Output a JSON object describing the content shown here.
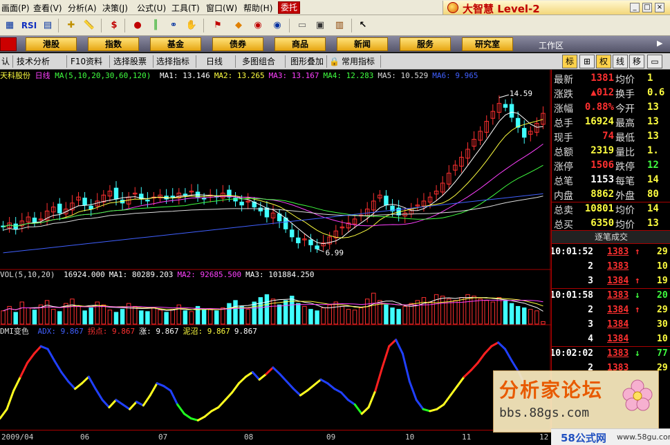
{
  "menu": {
    "items": [
      "画面(P)",
      "查看(V)",
      "分析(A)",
      "决策(J)",
      "公式(U)",
      "工具(T)",
      "窗口(W)",
      "帮助(H)"
    ],
    "entrust": "委托",
    "brand": "大智慧 Level-2"
  },
  "toolbar": {
    "rsi": "RSI",
    "dollar": "$"
  },
  "nav": {
    "buttons": [
      "港股",
      "指数",
      "基金",
      "债券",
      "商品",
      "新闻",
      "服务",
      "研究室"
    ],
    "workzone": "工作区"
  },
  "subbar": {
    "items": [
      "认",
      "技术分析",
      "F10资料",
      "选择股票",
      "选择指标",
      "日线",
      "多图组合",
      "图形叠加",
      "常用指标"
    ],
    "tabs": [
      "标",
      "⊞",
      "权",
      "线",
      "移"
    ]
  },
  "chart": {
    "stock_name": "天科股份",
    "period": "日线",
    "ma_label": "MA(5,10,20,30,60,120)",
    "ma_values": [
      {
        "label": "MA1: 13.146",
        "color": "#ffffff"
      },
      {
        "label": "MA2: 13.265",
        "color": "#ffff40"
      },
      {
        "label": "MA3: 13.167",
        "color": "#ff40ff"
      },
      {
        "label": "MA4: 12.283",
        "color": "#40ff40"
      },
      {
        "label": "MA5: 10.529",
        "color": "#dddddd"
      },
      {
        "label": "MA6: 9.965",
        "color": "#4060ff"
      }
    ],
    "high_label": "14.59",
    "low_label": "6.99",
    "vol_label": "VOL(5,10,20)",
    "vol_values": [
      {
        "label": "16924.000",
        "color": "#ffffff"
      },
      {
        "label": "MA1: 80289.203",
        "color": "#ffffff"
      },
      {
        "label": "MA2: 92685.500",
        "color": "#ff40ff"
      },
      {
        "label": "MA3: 101884.250",
        "color": "#ffffff"
      }
    ],
    "dmi_label": "DMI变色",
    "dmi_values": [
      {
        "label": "ADX: 9.867",
        "color": "#4060ff"
      },
      {
        "label": "拐点: 9.867",
        "color": "#ff3030"
      },
      {
        "label": "涨: 9.867",
        "color": "#ffffff"
      },
      {
        "label": "泥沼: 9.867",
        "color": "#ffff40"
      },
      {
        "label": "9.867",
        "color": "#ffffff"
      }
    ],
    "x_labels": [
      "2009/04",
      "06",
      "07",
      "08",
      "09",
      "10",
      "11",
      "12"
    ]
  },
  "chart_data": {
    "type": "candlestick",
    "price": {
      "ylim": [
        6,
        15.5
      ],
      "close": [
        8.1,
        8.3,
        8.0,
        8.4,
        8.6,
        8.3,
        8.5,
        8.9,
        9.1,
        8.8,
        9.0,
        9.3,
        9.6,
        9.2,
        9.0,
        9.4,
        9.7,
        9.9,
        9.5,
        9.3,
        9.6,
        9.8,
        9.5,
        9.4,
        9.6,
        9.7,
        9.5,
        9.6,
        9.8,
        9.7,
        9.9,
        9.6,
        9.5,
        9.7,
        9.6,
        9.8,
        9.6,
        9.4,
        9.2,
        9.4,
        9.1,
        8.9,
        8.6,
        8.8,
        8.4,
        8.0,
        7.6,
        7.3,
        7.5,
        7.2,
        7.0,
        7.3,
        7.6,
        7.9,
        8.1,
        8.3,
        8.5,
        8.7,
        9.0,
        9.4,
        9.7,
        9.2,
        8.9,
        8.7,
        8.8,
        9.0,
        9.2,
        9.4,
        9.6,
        9.9,
        10.3,
        10.8,
        11.2,
        11.6,
        12.0,
        12.5,
        12.9,
        13.4,
        13.9,
        14.3,
        14.1,
        13.6,
        13.1,
        12.6,
        12.9,
        13.3,
        13.8
      ],
      "high_value": 14.59,
      "low_value": 6.99
    },
    "volume": {
      "ylim": [
        0,
        300000
      ],
      "values": [
        90000,
        120000,
        80000,
        150000,
        110000,
        95000,
        130000,
        160000,
        100000,
        85000,
        140000,
        170000,
        120000,
        90000,
        110000,
        150000,
        130000,
        95000,
        80000,
        100000,
        140000,
        120000,
        90000,
        85000,
        110000,
        95000,
        80000,
        100000,
        130000,
        90000,
        85000,
        120000,
        95000,
        100000,
        90000,
        110000,
        140000,
        160000,
        120000,
        100000,
        150000,
        180000,
        200000,
        170000,
        130000,
        160000,
        190000,
        140000,
        120000,
        100000,
        90000,
        110000,
        130000,
        150000,
        120000,
        100000,
        95000,
        110000,
        170000,
        210000,
        160000,
        130000,
        110000,
        100000,
        120000,
        140000,
        160000,
        180000,
        150000,
        200000,
        190000,
        170000,
        160000,
        180000,
        200000,
        190000,
        170000,
        160000,
        150000,
        180000,
        160000,
        140000,
        120000,
        110000,
        100000,
        90000,
        16924
      ]
    },
    "dmi": {
      "ylim": [
        0,
        100
      ],
      "values": [
        10,
        20,
        40,
        55,
        70,
        80,
        88,
        85,
        72,
        60,
        50,
        42,
        48,
        55,
        42,
        30,
        22,
        30,
        25,
        20,
        28,
        24,
        35,
        48,
        45,
        40,
        25,
        15,
        10,
        8,
        12,
        18,
        22,
        30,
        38,
        48,
        55,
        60,
        52,
        58,
        65,
        58,
        50,
        42,
        35,
        40,
        46,
        52,
        48,
        42,
        38,
        30,
        25,
        15,
        22,
        40,
        65,
        88,
        95,
        80,
        50,
        30,
        20,
        18,
        20,
        25,
        35,
        45,
        55,
        62,
        70,
        80,
        88,
        92,
        85,
        72,
        60,
        45,
        30
      ]
    }
  },
  "quote": {
    "rows": [
      {
        "l1": "最新",
        "v1": "1381",
        "c1": "red",
        "l2": "均价",
        "v2": "1",
        "c2": "yellow"
      },
      {
        "l1": "涨跌",
        "v1": "▲012",
        "c1": "red",
        "l2": "换手",
        "v2": "0.6",
        "c2": "yellow"
      },
      {
        "l1": "涨幅",
        "v1": "0.88%",
        "c1": "red",
        "l2": "今开",
        "v2": "13",
        "c2": "yellow"
      },
      {
        "l1": "总手",
        "v1": "16924",
        "c1": "yellow",
        "l2": "最高",
        "v2": "13",
        "c2": "yellow"
      },
      {
        "l1": "现手",
        "v1": "74",
        "c1": "red",
        "l2": "最低",
        "v2": "13",
        "c2": "yellow"
      },
      {
        "l1": "总额",
        "v1": "2319",
        "c1": "yellow",
        "l2": "量比",
        "v2": "1.",
        "c2": "yellow"
      },
      {
        "l1": "涨停",
        "v1": "1506",
        "c1": "red",
        "l2": "跌停",
        "v2": "12",
        "c2": "green"
      },
      {
        "l1": "总笔",
        "v1": "1153",
        "c1": "white",
        "l2": "每笔",
        "v2": "14",
        "c2": "yellow"
      },
      {
        "l1": "内盘",
        "v1": "8862",
        "c1": "yellow",
        "l2": "外盘",
        "v2": "80",
        "c2": "yellow"
      },
      {
        "l1": "总卖",
        "v1": "10801",
        "c1": "yellow",
        "l2": "均价",
        "v2": "14",
        "c2": "yellow"
      },
      {
        "l1": "总买",
        "v1": "6350",
        "c1": "yellow",
        "l2": "均价",
        "v2": "13",
        "c2": "yellow"
      }
    ],
    "trade_header": "逐笔成交",
    "trades": [
      {
        "time": "10:01:52",
        "price": "1383",
        "arrow": "up",
        "vol": "29"
      },
      {
        "time": "2",
        "price": "1383",
        "arrow": "",
        "vol": "10"
      },
      {
        "time": "3",
        "price": "1384",
        "arrow": "up",
        "vol": "19"
      },
      {
        "time": "10:01:58",
        "price": "1383",
        "arrow": "down",
        "vol": "20"
      },
      {
        "time": "2",
        "price": "1384",
        "arrow": "up",
        "vol": "29"
      },
      {
        "time": "3",
        "price": "1384",
        "arrow": "",
        "vol": "30"
      },
      {
        "time": "4",
        "price": "1384",
        "arrow": "",
        "vol": "10"
      },
      {
        "time": "10:02:02",
        "price": "1383",
        "arrow": "down",
        "vol": "77"
      },
      {
        "time": "2",
        "price": "1383",
        "arrow": "",
        "vol": "29"
      }
    ]
  },
  "watermark": {
    "title": "分析家论坛",
    "url": "bbs.88gs.com"
  },
  "corner_badge": {
    "title": "58公式网",
    "url": "www.58gu.com"
  }
}
